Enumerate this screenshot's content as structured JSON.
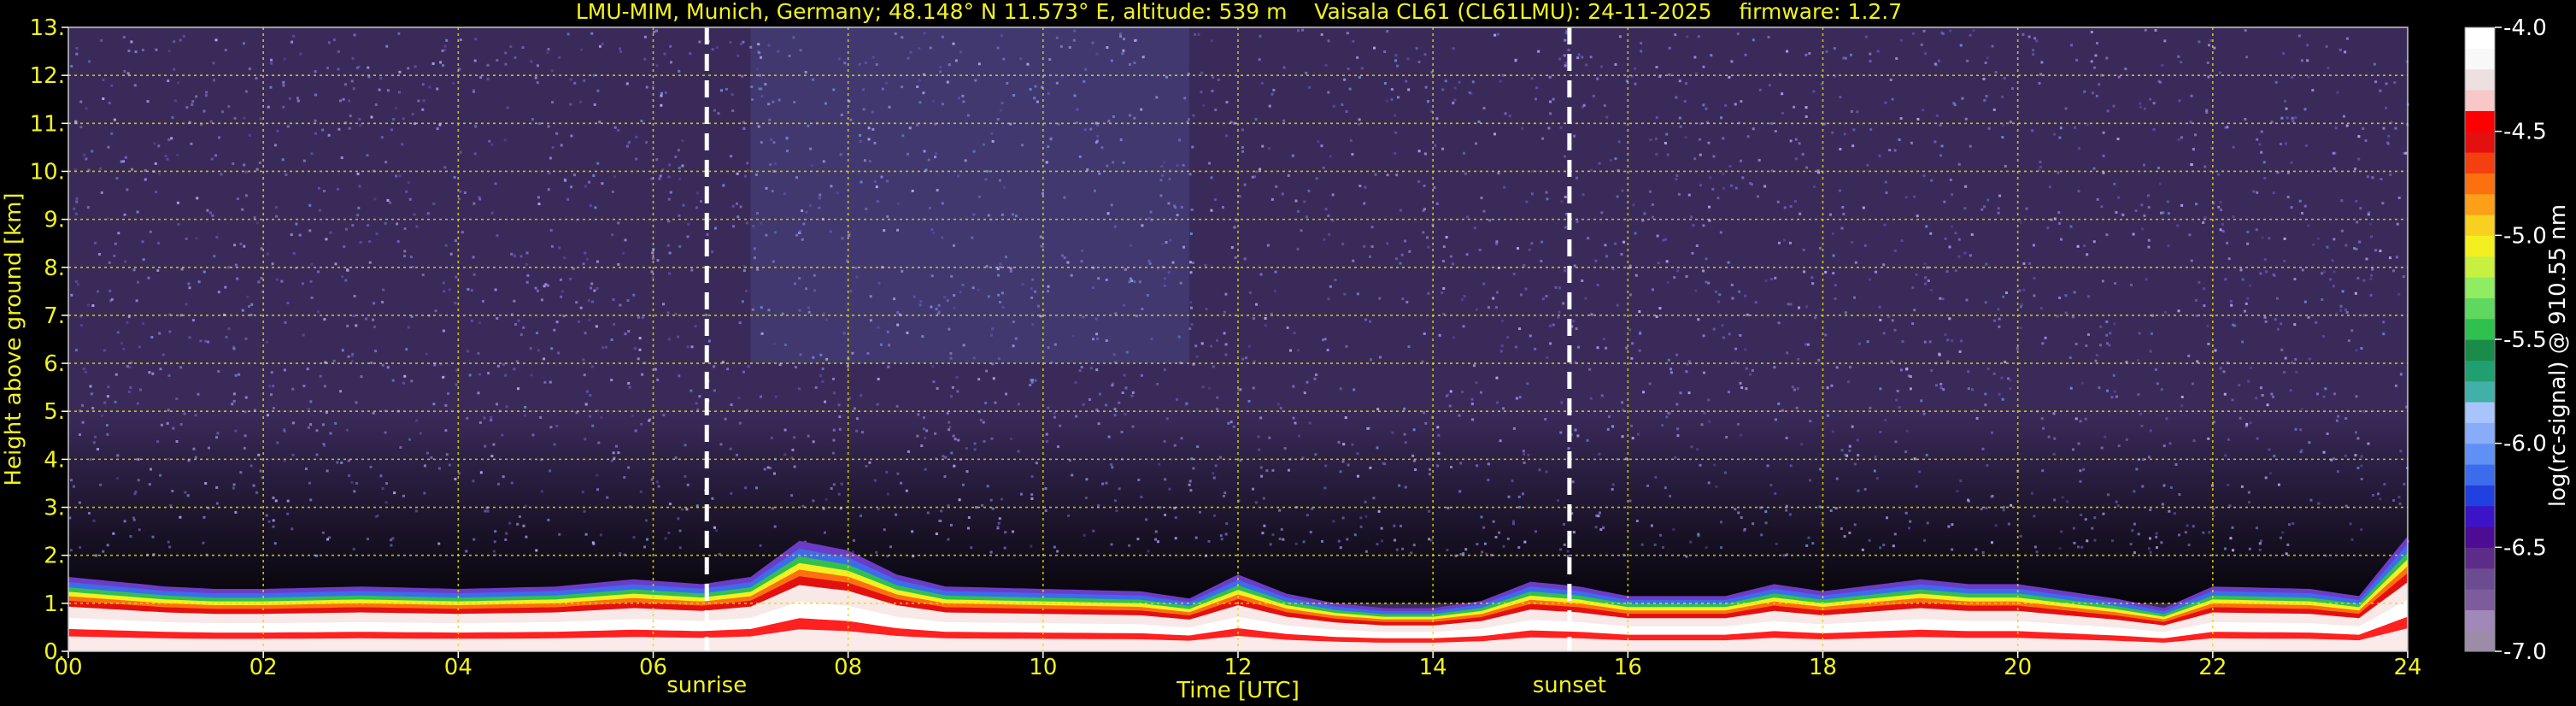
{
  "chart_data": {
    "type": "heatmap",
    "title": "LMU-MIM, Munich, Germany; 48.148° N 11.573° E, altitude: 539 m    Vaisala CL61 (CL61LMU): 24-11-2025    firmware: 1.2.7",
    "xlabel": "Time [UTC]",
    "ylabel": "Height above ground [km]",
    "xlim": [
      0,
      24
    ],
    "ylim": [
      0,
      13
    ],
    "x_ticks": [
      0,
      2,
      4,
      6,
      8,
      10,
      12,
      14,
      16,
      18,
      20,
      22,
      24
    ],
    "x_tick_labels": [
      "00",
      "02",
      "04",
      "06",
      "08",
      "10",
      "12",
      "14",
      "16",
      "18",
      "20",
      "22",
      "24"
    ],
    "y_ticks": [
      0,
      1,
      2,
      3,
      4,
      5,
      6,
      7,
      8,
      9,
      10,
      11,
      12,
      13
    ],
    "y_tick_labels": [
      "0.",
      "1.",
      "2.",
      "3.",
      "4.",
      "5.",
      "6.",
      "7.",
      "8.",
      "9.",
      "10.",
      "11.",
      "12.",
      "13."
    ],
    "grid": true,
    "grid_color": "#e0e000",
    "background": "#000000",
    "annotations": [
      {
        "label": "sunrise",
        "x": 6.55
      },
      {
        "label": "sunset",
        "x": 15.4
      }
    ],
    "boundary_layer_top_km": [
      [
        0,
        1.55
      ],
      [
        0.5,
        1.45
      ],
      [
        1,
        1.35
      ],
      [
        1.5,
        1.3
      ],
      [
        2,
        1.3
      ],
      [
        3,
        1.35
      ],
      [
        4,
        1.3
      ],
      [
        5,
        1.35
      ],
      [
        5.8,
        1.5
      ],
      [
        6.5,
        1.4
      ],
      [
        7,
        1.55
      ],
      [
        7.5,
        2.3
      ],
      [
        8,
        2.1
      ],
      [
        8.5,
        1.6
      ],
      [
        9,
        1.35
      ],
      [
        10,
        1.3
      ],
      [
        11,
        1.25
      ],
      [
        11.5,
        1.1
      ],
      [
        12,
        1.6
      ],
      [
        12.5,
        1.2
      ],
      [
        13,
        1.0
      ],
      [
        13.5,
        0.9
      ],
      [
        14,
        0.9
      ],
      [
        14.5,
        1.05
      ],
      [
        15,
        1.45
      ],
      [
        15.5,
        1.35
      ],
      [
        16,
        1.15
      ],
      [
        17,
        1.15
      ],
      [
        17.5,
        1.4
      ],
      [
        18,
        1.25
      ],
      [
        19,
        1.5
      ],
      [
        19.5,
        1.4
      ],
      [
        20,
        1.4
      ],
      [
        21,
        1.1
      ],
      [
        21.5,
        0.9
      ],
      [
        22,
        1.35
      ],
      [
        23,
        1.3
      ],
      [
        23.5,
        1.15
      ],
      [
        24,
        2.4
      ]
    ],
    "colorbar": {
      "label": "log(rc-signal) @ 910.55 nm",
      "min": -7.0,
      "max": -4.0,
      "ticks": [
        -4.0,
        -4.5,
        -5.0,
        -5.5,
        -6.0,
        -6.5,
        -7.0
      ],
      "tick_labels": [
        "-4.0",
        "-4.5",
        "-5.0",
        "-5.5",
        "-6.0",
        "-6.5",
        "-7.0"
      ],
      "colors": [
        "#9c8ca8",
        "#a088b8",
        "#7c5c9c",
        "#6c4c90",
        "#5c2c88",
        "#4c0c94",
        "#3c14c8",
        "#2040e0",
        "#3c6cec",
        "#6090f4",
        "#88acf8",
        "#a8c4fa",
        "#40b0a8",
        "#20a070",
        "#188c48",
        "#30c050",
        "#60d860",
        "#90ec60",
        "#c8f040",
        "#f4f020",
        "#f8d020",
        "#fca018",
        "#fc7010",
        "#f44010",
        "#e41010",
        "#ff0000",
        "#f8c8c8",
        "#ece0e0",
        "#f8f8f8",
        "#ffffff"
      ]
    }
  }
}
